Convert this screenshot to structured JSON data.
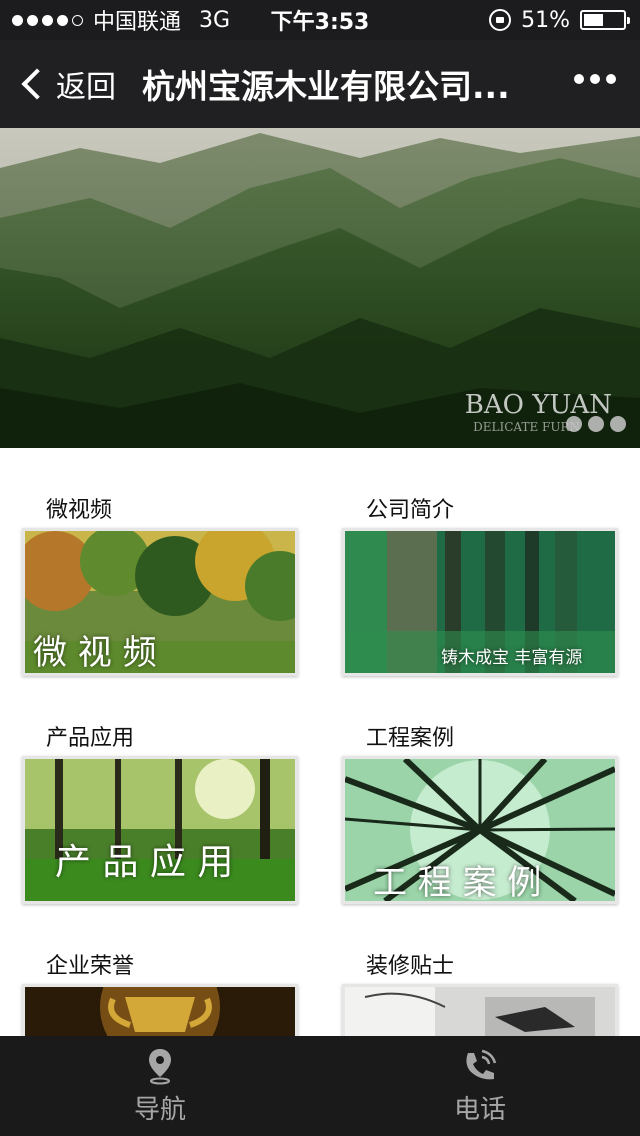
{
  "status_bar": {
    "carrier": "中国联通",
    "network": "3G",
    "time": "下午3:53",
    "battery": "51%",
    "battery_level": 0.51
  },
  "nav": {
    "back_label": "返回",
    "title": "杭州宝源木业有限公司..."
  },
  "banner": {
    "brand": "BAO YUAN",
    "brand_sub": "DELICATE FURN"
  },
  "cards": [
    {
      "title": "微视频",
      "overlay": "微 视 频"
    },
    {
      "title": "公司简介",
      "overlay": "铸木成宝  丰富有源"
    },
    {
      "title": "产品应用",
      "overlay": "产 品 应 用"
    },
    {
      "title": "工程案例",
      "overlay": "工 程 案 例"
    },
    {
      "title": "企业荣誉",
      "overlay": ""
    },
    {
      "title": "装修贴士",
      "overlay": ""
    }
  ],
  "tabbar": {
    "nav_label": "导航",
    "phone_label": "电话"
  }
}
